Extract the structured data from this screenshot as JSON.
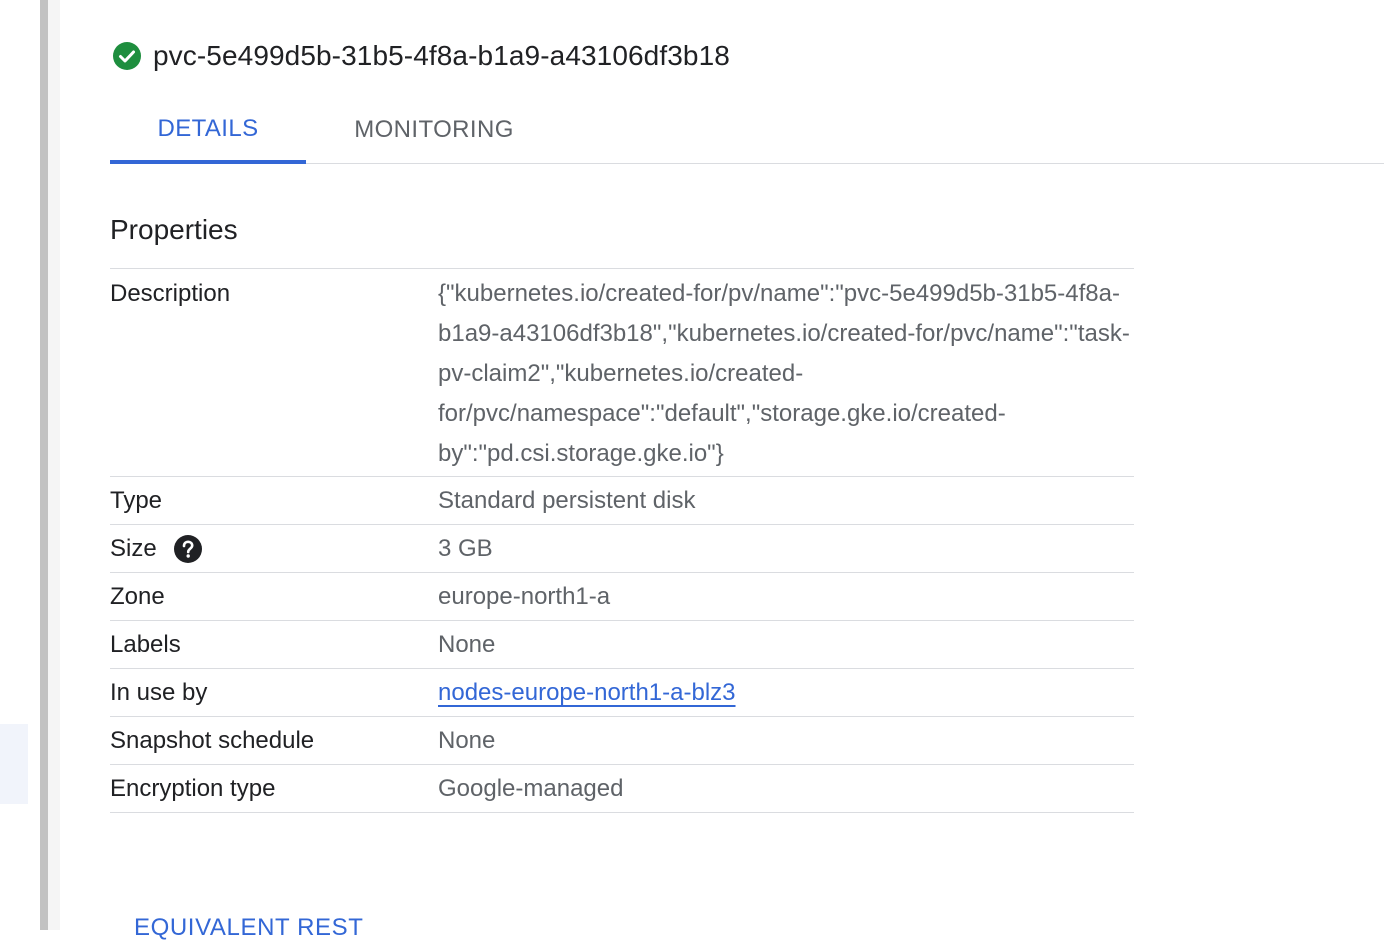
{
  "resource": {
    "title": "pvc-5e499d5b-31b5-4f8a-b1a9-a43106df3b18",
    "status_icon": "check-circle-icon",
    "status_color": "#1e8e3e"
  },
  "tabs": [
    {
      "label": "DETAILS",
      "active": true
    },
    {
      "label": "MONITORING",
      "active": false
    }
  ],
  "properties": {
    "title": "Properties",
    "rows": [
      {
        "key": "Description",
        "value": "{\"kubernetes.io/created-for/pv/name\":\"pvc-5e499d5b-31b5-4f8a-b1a9-a43106df3b18\",\"kubernetes.io/created-for/pvc/name\":\"task-pv-claim2\",\"kubernetes.io/created-for/pvc/namespace\":\"default\",\"storage.gke.io/created-by\":\"pd.csi.storage.gke.io\"}"
      },
      {
        "key": "Type",
        "value": "Standard persistent disk"
      },
      {
        "key": "Size",
        "value": "3 GB",
        "help_icon": "help-circle-icon"
      },
      {
        "key": "Zone",
        "value": "europe-north1-a"
      },
      {
        "key": "Labels",
        "value": "None"
      },
      {
        "key": "In use by",
        "value": "nodes-europe-north1-a-blz3",
        "is_link": true
      },
      {
        "key": "Snapshot schedule",
        "value": "None"
      },
      {
        "key": "Encryption type",
        "value": "Google-managed"
      }
    ]
  },
  "footer": {
    "equivalent_rest_label": "EQUIVALENT REST"
  },
  "colors": {
    "accent": "#3367d6",
    "success": "#1e8e3e",
    "text_primary": "#202124",
    "text_secondary": "#5f6368",
    "divider": "#dadce0"
  }
}
